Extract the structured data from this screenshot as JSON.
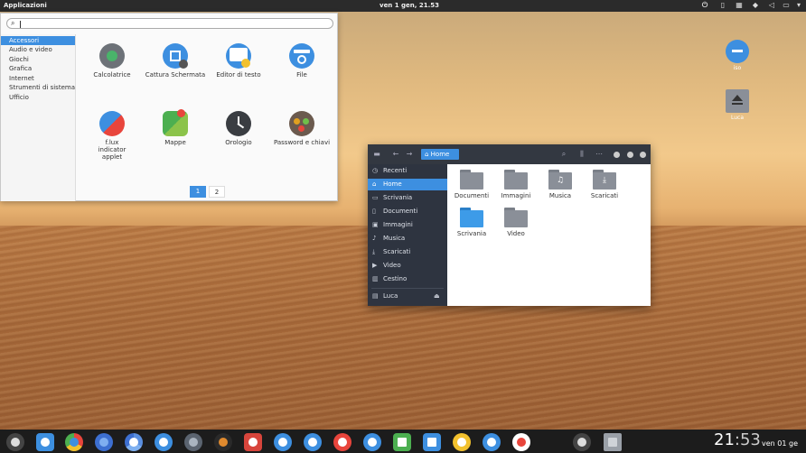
{
  "topbar": {
    "apps_label": "Applicazioni",
    "clock": "ven  1 gen, 21.53",
    "indicators": [
      "power-icon",
      "volume-icon",
      "battery-icon",
      "dropbox-icon",
      "wifi-icon",
      "calendar-icon",
      "clipboard-icon",
      "bell-icon"
    ]
  },
  "menu": {
    "search_placeholder": "",
    "categories": [
      "Accessori",
      "Audio e video",
      "Giochi",
      "Grafica",
      "Internet",
      "Strumenti di sistema",
      "Ufficio"
    ],
    "apps": [
      {
        "label": "Calcolatrice",
        "icon": "calculator-icon"
      },
      {
        "label": "Cattura Schermata",
        "icon": "screenshot-icon"
      },
      {
        "label": "Editor di testo",
        "icon": "text-editor-icon"
      },
      {
        "label": "File",
        "icon": "files-icon"
      },
      {
        "label": "f.lux indicator applet",
        "icon": "flux-icon"
      },
      {
        "label": "Mappe",
        "icon": "maps-icon"
      },
      {
        "label": "Orologio",
        "icon": "clock-icon"
      },
      {
        "label": "Password e chiavi",
        "icon": "passwords-icon"
      }
    ],
    "pages": [
      "1",
      "2"
    ]
  },
  "desktop": {
    "icons": [
      {
        "label": "iso",
        "icon": "disc-icon"
      },
      {
        "label": "Luca",
        "icon": "drive-icon"
      }
    ]
  },
  "file_manager": {
    "breadcrumb": "Home",
    "sidebar": [
      {
        "label": "Recenti",
        "icon": "clock-icon"
      },
      {
        "label": "Home",
        "icon": "home-icon"
      },
      {
        "label": "Scrivania",
        "icon": "desktop-icon"
      },
      {
        "label": "Documenti",
        "icon": "document-icon"
      },
      {
        "label": "Immagini",
        "icon": "image-icon"
      },
      {
        "label": "Musica",
        "icon": "music-icon"
      },
      {
        "label": "Scaricati",
        "icon": "download-icon"
      },
      {
        "label": "Video",
        "icon": "video-icon"
      },
      {
        "label": "Cestino",
        "icon": "trash-icon"
      },
      {
        "label": "Luca",
        "icon": "drive-icon"
      }
    ],
    "folders": [
      {
        "label": "Documenti",
        "glyph": ""
      },
      {
        "label": "Immagini",
        "glyph": ""
      },
      {
        "label": "Musica",
        "glyph": "♫"
      },
      {
        "label": "Scaricati",
        "glyph": "⤓"
      },
      {
        "label": "Scrivania",
        "glyph": ""
      },
      {
        "label": "Video",
        "glyph": ""
      }
    ]
  },
  "dock": {
    "apps": [
      "launcher-icon",
      "files-icon",
      "chrome-icon",
      "globe-icon",
      "chromium-icon",
      "download-icon",
      "settings-icon",
      "music-icon",
      "app-store-icon",
      "dropbox-icon",
      "text-editor-icon",
      "vivaldi-icon",
      "clock-icon",
      "sheets-icon",
      "docs-icon",
      "notes-icon",
      "contacts-icon",
      "record-icon",
      "power-icon",
      "trash-icon"
    ],
    "clock_hours": "21",
    "clock_minutes": "53",
    "date": "ven 01 ge"
  },
  "colors": {
    "accent": "#3d8fe0",
    "topbar": "#2b2b2b",
    "fm_sidebar": "#2e3440",
    "folder": "#8a8f98"
  }
}
